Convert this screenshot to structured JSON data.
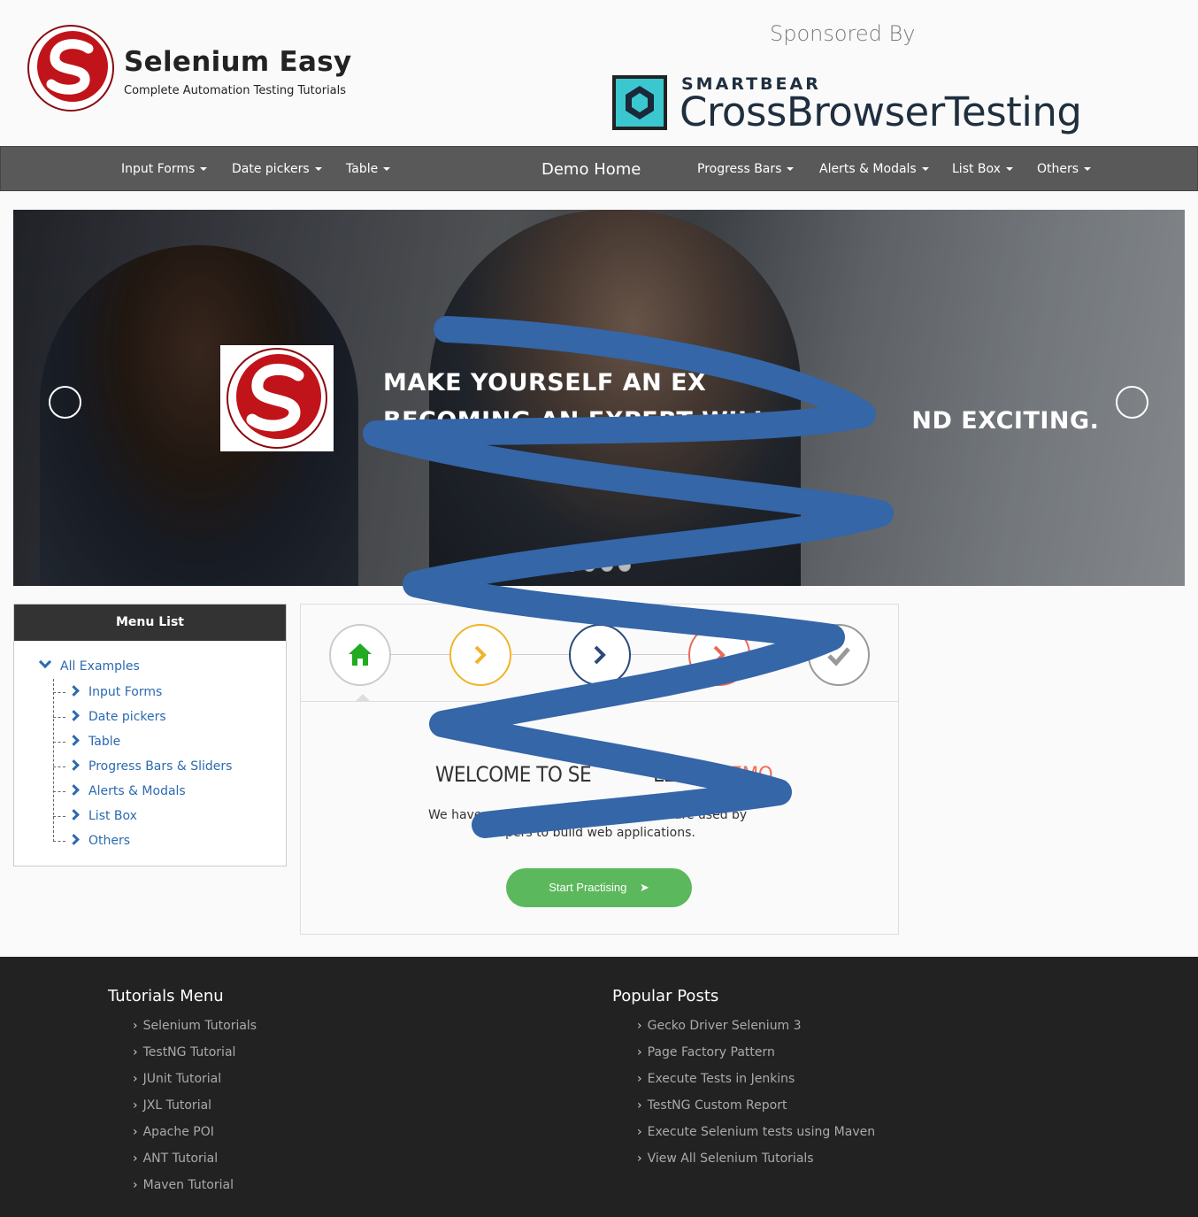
{
  "header": {
    "brand_title": "Selenium Easy",
    "brand_tagline": "Complete Automation Testing Tutorials",
    "sponsored_label": "Sponsored By",
    "sponsor_top": "SMARTBEAR",
    "sponsor_bottom": "CrossBrowserTesting"
  },
  "nav": {
    "items": [
      {
        "label": "Input Forms"
      },
      {
        "label": "Date pickers"
      },
      {
        "label": "Table"
      },
      {
        "label": "Demo Home"
      },
      {
        "label": "Progress Bars"
      },
      {
        "label": "Alerts & Modals"
      },
      {
        "label": "List Box"
      },
      {
        "label": "Others"
      }
    ]
  },
  "carousel": {
    "line1": "MAKE YOURSELF AN EX",
    "line2": "BECOMING AN EXPERT WILL B",
    "line2_end": "ND EXCITING.",
    "active_slide": 1,
    "slide_count": 4
  },
  "menu": {
    "title": "Menu List",
    "root": "All Examples",
    "items": [
      {
        "label": "Input Forms"
      },
      {
        "label": "Date pickers"
      },
      {
        "label": "Table"
      },
      {
        "label": "Progress Bars & Sliders"
      },
      {
        "label": "Alerts & Modals"
      },
      {
        "label": "List Box"
      },
      {
        "label": "Others"
      }
    ]
  },
  "wizard": {
    "steps": [
      {
        "icon": "home-icon",
        "color": "#22aa22"
      },
      {
        "icon": "chevron-right-icon",
        "color": "#f0b428"
      },
      {
        "icon": "chevron-right-icon",
        "color": "#2a4a7a"
      },
      {
        "icon": "chevron-right-icon",
        "color": "#e86a5a"
      },
      {
        "icon": "check-icon",
        "color": "#999999"
      }
    ],
    "welcome": "WELCOME TO SE",
    "welcome_mid": "LEASY",
    "welcome_demo": "DEMO",
    "text1_start": "We have",
    "text1_end": "hat are used by",
    "text2": "elopers to build web applications.",
    "start_button": "Start Practising"
  },
  "footer": {
    "tutorials_title": "Tutorials Menu",
    "tutorials": [
      "Selenium Tutorials",
      "TestNG Tutorial",
      "JUnit Tutorial",
      "JXL Tutorial",
      "Apache POI",
      "ANT Tutorial",
      "Maven Tutorial"
    ],
    "popular_title": "Popular Posts",
    "popular": [
      "Gecko Driver Selenium 3",
      "Page Factory Pattern",
      "Execute Tests in Jenkins",
      "TestNG Custom Report",
      "Execute Selenium tests using Maven",
      "View All Selenium Tutorials"
    ]
  },
  "colors": {
    "navbar": "#595959",
    "link_blue": "#2a6ab0",
    "button_green": "#5cb85c",
    "scribble_blue": "#3466a8",
    "brand_red": "#c0141a"
  }
}
